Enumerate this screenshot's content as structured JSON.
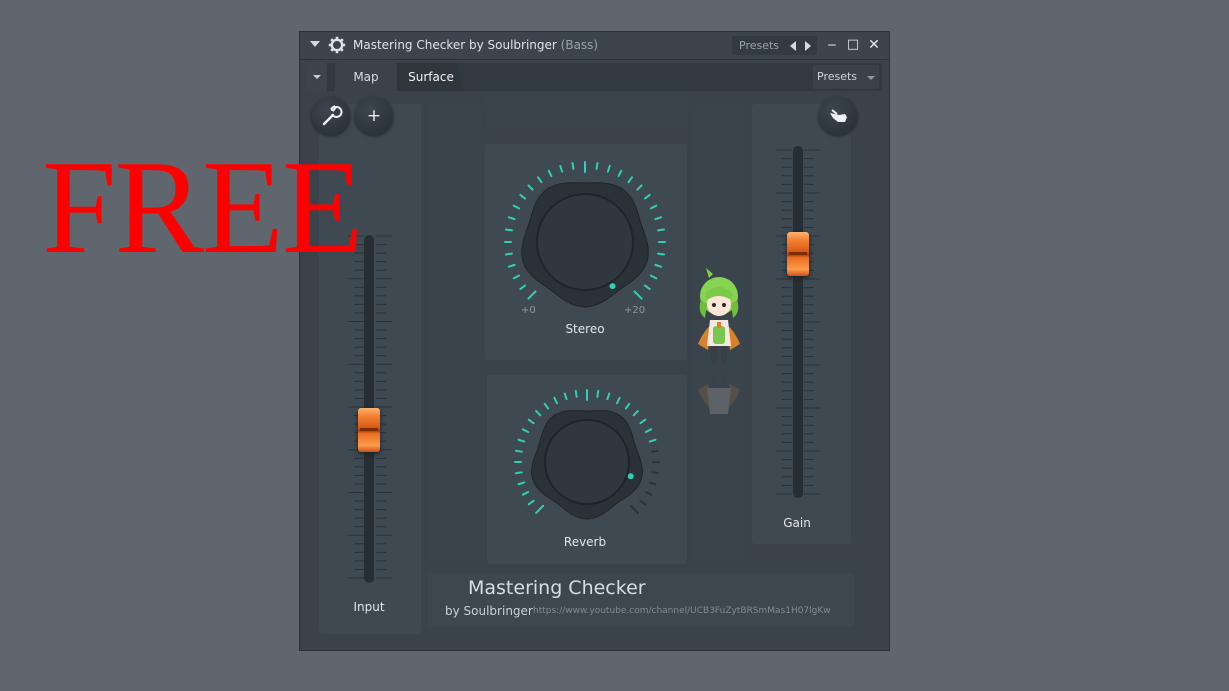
{
  "window": {
    "title": "Mastering Checker by Soulbringer",
    "title_suffix": "(Bass)",
    "presets_label": "Presets",
    "minimize": "‒",
    "maximize": "□",
    "close": "✕"
  },
  "tabs": {
    "map": "Map",
    "surface": "Surface",
    "presets": "Presets",
    "active": "Surface"
  },
  "tools": {
    "wrench": "wrench-icon",
    "plus": "+",
    "hand": "hand-icon"
  },
  "controls": {
    "input": {
      "label": "Input",
      "level": 0.43
    },
    "gain": {
      "label": "Gain",
      "level": 0.72
    },
    "stereo": {
      "label": "Stereo",
      "min_label": "+0",
      "max_label": "+20"
    },
    "reverb": {
      "label": "Reverb"
    }
  },
  "brand": {
    "title": "Mastering Checker",
    "by": "by Soulbringer",
    "url": "https://www.youtube.com/channel/UCB3FuZytBRSmMas1H07lgKw"
  },
  "overlay": {
    "text": "FREE"
  },
  "colors": {
    "accent": "#2fd0b4",
    "fader": "#f07a2c",
    "overlay": "#ff0000"
  }
}
